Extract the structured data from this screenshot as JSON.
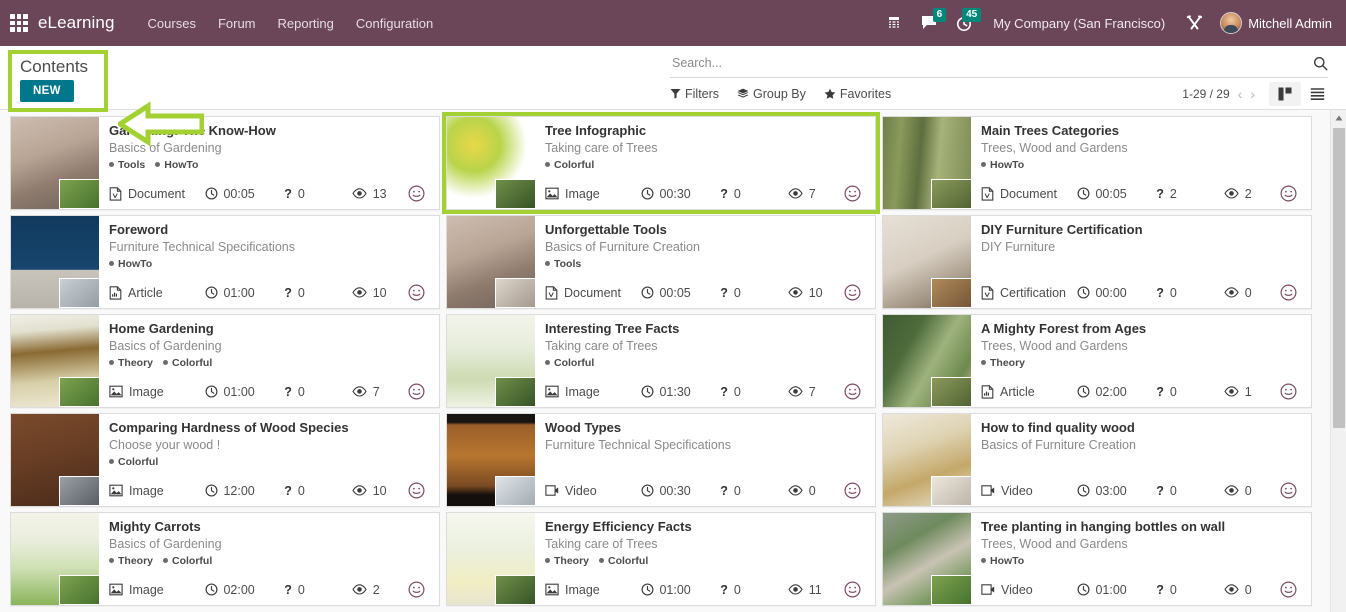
{
  "navbar": {
    "apps_icon": "apps-grid-icon",
    "brand": "eLearning",
    "menu": [
      "Courses",
      "Forum",
      "Reporting",
      "Configuration"
    ],
    "phone_icon": "dialpad-icon",
    "chat_icon": "chat-bubble-icon",
    "chat_badge": "6",
    "clock_icon": "clock-icon",
    "clock_badge": "45",
    "company": "My Company (San Francisco)",
    "debug_icon": "tools-icon",
    "avatar_icon": "user-avatar",
    "user": "Mitchell Admin",
    "accent": "#6b4558",
    "badge_color": "#00887a"
  },
  "control_panel": {
    "breadcrumb": "Contents",
    "new_button": "NEW",
    "new_button_color": "#00778b",
    "highlight_color": "#a3d133",
    "search": {
      "placeholder": "Search...",
      "value": "",
      "icon": "search-icon"
    },
    "filters": [
      {
        "label": "Filters",
        "icon": "funnel-icon"
      },
      {
        "label": "Group By",
        "icon": "layers-icon"
      },
      {
        "label": "Favorites",
        "icon": "star-icon"
      }
    ],
    "pager": "1-29 / 29",
    "prev_icon": "chevron-left-icon",
    "next_icon": "chevron-right-icon",
    "views": [
      {
        "name": "kanban-view",
        "icon": "kanban-icon",
        "active": true
      },
      {
        "name": "list-view",
        "icon": "list-icon",
        "active": false
      }
    ]
  },
  "cards": [
    {
      "title": "Gardening: The Know-How",
      "course": "Basics of Gardening",
      "tags": [
        "Tools",
        "HowTo"
      ],
      "type": "Document",
      "type_icon": "document-icon",
      "duration": "00:05",
      "questions": "0",
      "views": "13",
      "smiley_icon": "smiley-icon",
      "highlighted": false,
      "thumb": "desk-mug-phone",
      "thumb_css": "linear-gradient(160deg,#cdbdb0 0%,#b9a596 38%,#8e7b6e 66%,#6f625a 100%)",
      "inset_css": "linear-gradient(140deg,#7da14f,#3f6b2a)"
    },
    {
      "title": "Tree Infographic",
      "course": "Taking care of Trees",
      "tags": [
        "Colorful"
      ],
      "type": "Image",
      "type_icon": "image-icon",
      "duration": "00:30",
      "questions": "0",
      "views": "7",
      "smiley_icon": "smiley-icon",
      "highlighted": true,
      "thumb": "tree-infographic",
      "thumb_css": "radial-gradient(circle at 30% 30%,#e8d84a 0%,#b9d44a 30%,#ffffff 60%),linear-gradient(#ffffff,#ffffff)",
      "inset_css": "linear-gradient(140deg,#6f8f4a,#2f4a22)"
    },
    {
      "title": "Main Trees Categories",
      "course": "Trees, Wood and Gardens",
      "tags": [
        "HowTo"
      ],
      "type": "Document",
      "type_icon": "document-icon",
      "duration": "00:05",
      "questions": "2",
      "views": "2",
      "smiley_icon": "smiley-icon",
      "highlighted": false,
      "thumb": "forest-trees",
      "thumb_css": "linear-gradient(95deg,#6f7f4a 0%,#8a9a5b 20%,#5e6e3f 42%,#a8b27a 62%,#7b8a55 100%)",
      "inset_css": "linear-gradient(140deg,#8a9a5b,#4a5b2f)"
    },
    {
      "title": "Foreword",
      "course": "Furniture Technical Specifications",
      "tags": [
        "HowTo"
      ],
      "type": "Article",
      "type_icon": "article-icon",
      "duration": "01:00",
      "questions": "0",
      "views": "10",
      "smiley_icon": "smiley-icon",
      "highlighted": false,
      "thumb": "blue-living-room",
      "thumb_css": "linear-gradient(180deg,#123a5e 0%,#16456d 58%,#c9c4bb 59%,#b8b3ab 100%)",
      "inset_css": "linear-gradient(140deg,#c9cfd4,#8d959c)"
    },
    {
      "title": "Unforgettable Tools",
      "course": "Basics of Furniture Creation",
      "tags": [
        "Tools"
      ],
      "type": "Document",
      "type_icon": "document-icon",
      "duration": "00:05",
      "questions": "0",
      "views": "10",
      "smiley_icon": "smiley-icon",
      "highlighted": false,
      "thumb": "desk-mug-phone",
      "thumb_css": "linear-gradient(160deg,#cdbdb0 0%,#b9a596 38%,#8e7b6e 66%,#6f625a 100%)",
      "inset_css": "linear-gradient(140deg,#ddd6cc,#9b8f83)"
    },
    {
      "title": "DIY Furniture Certification",
      "course": "DIY Furniture",
      "tags": [],
      "type": "Certification",
      "type_icon": "certification-icon",
      "duration": "00:00",
      "questions": "0",
      "views": "0",
      "smiley_icon": "smiley-icon",
      "highlighted": false,
      "thumb": "desk-flowers",
      "thumb_css": "linear-gradient(155deg,#e6e0d6 0%,#d8cfc2 45%,#9c8f7e 80%,#6d6054 100%)",
      "inset_css": "linear-gradient(140deg,#b08a5a,#6b4f33)"
    },
    {
      "title": "Home Gardening",
      "course": "Basics of Gardening",
      "tags": [
        "Theory",
        "Colorful"
      ],
      "type": "Image",
      "type_icon": "image-icon",
      "duration": "01:00",
      "questions": "0",
      "views": "7",
      "smiley_icon": "smiley-icon",
      "highlighted": false,
      "thumb": "home-gardening-infographic",
      "thumb_css": "linear-gradient(175deg,#f0efe6 0%,#e2e0cf 18%,#8a6a33 40%,#d7cfa8 70%,#eee9d6 100%)",
      "inset_css": "linear-gradient(140deg,#7da14f,#3f6b2a)"
    },
    {
      "title": "Interesting Tree Facts",
      "course": "Taking care of Trees",
      "tags": [
        "Colorful"
      ],
      "type": "Image",
      "type_icon": "image-icon",
      "duration": "01:30",
      "questions": "0",
      "views": "7",
      "smiley_icon": "smiley-icon",
      "highlighted": false,
      "thumb": "tree-facts-infographic",
      "thumb_css": "linear-gradient(180deg,#f2f4ea 0%,#e7eddc 35%,#cddbb2 70%,#eef2e4 100%)",
      "inset_css": "linear-gradient(140deg,#6f8f4a,#2f4a22)"
    },
    {
      "title": "A Mighty Forest from Ages",
      "course": "Trees, Wood and Gardens",
      "tags": [
        "Theory"
      ],
      "type": "Article",
      "type_icon": "article-icon",
      "duration": "02:00",
      "questions": "0",
      "views": "1",
      "smiley_icon": "smiley-icon",
      "highlighted": false,
      "thumb": "green-tree-sky",
      "thumb_css": "linear-gradient(120deg,#3f5b33 0%,#4e6b3c 30%,#9fb27e 55%,#6d8a4e 80%,#c9bfa6 100%)",
      "inset_css": "linear-gradient(140deg,#8a9a5b,#4a5b2f)"
    },
    {
      "title": "Comparing Hardness of Wood Species",
      "course": "Choose your wood !",
      "tags": [
        "Colorful"
      ],
      "type": "Image",
      "type_icon": "image-icon",
      "duration": "12:00",
      "questions": "0",
      "views": "10",
      "smiley_icon": "smiley-icon",
      "highlighted": false,
      "thumb": "wood-hardness-chart",
      "thumb_css": "linear-gradient(165deg,#7a4a2c 0%,#6a3f25 40%,#5a3520 70%,#4a2b19 100%)",
      "inset_css": "linear-gradient(140deg,#9aa0a6,#4e545a)"
    },
    {
      "title": "Wood Types",
      "course": "Furniture Technical Specifications",
      "tags": [],
      "type": "Video",
      "type_icon": "video-icon",
      "duration": "00:30",
      "questions": "0",
      "views": "0",
      "smiley_icon": "smiley-icon",
      "highlighted": false,
      "thumb": "woman-video-wood",
      "thumb_css": "linear-gradient(180deg,#1a1410 0%,#1a1410 9%,#9a5f2a 12%,#b8762f 45%,#7a4a22 78%,#140f0c 88%,#140f0c 100%)",
      "inset_css": "linear-gradient(140deg,#dfe3e6,#9aa4ac)"
    },
    {
      "title": "How to find quality wood",
      "course": "Basics of Furniture Creation",
      "tags": [],
      "type": "Video",
      "type_icon": "video-icon",
      "duration": "03:00",
      "questions": "0",
      "views": "0",
      "smiley_icon": "smiley-icon",
      "highlighted": false,
      "thumb": "wood-samples",
      "thumb_css": "linear-gradient(160deg,#efe9dc 0%,#ded3b3 35%,#c4a86a 65%,#e9e2d0 100%)",
      "inset_css": "linear-gradient(140deg,#ece7de,#b7ada0)"
    },
    {
      "title": "Mighty Carrots",
      "course": "Basics of Gardening",
      "tags": [
        "Theory",
        "Colorful"
      ],
      "type": "Image",
      "type_icon": "image-icon",
      "duration": "02:00",
      "questions": "0",
      "views": "2",
      "smiley_icon": "smiley-icon",
      "highlighted": false,
      "thumb": "carrots-infographic",
      "thumb_css": "linear-gradient(180deg,#f4f3e8 0%,#e9eedc 30%,#cfe0b4 60%,#8ab45a 100%)",
      "inset_css": "linear-gradient(140deg,#7da14f,#3f6b2a)"
    },
    {
      "title": "Energy Efficiency Facts",
      "course": "Taking care of Trees",
      "tags": [
        "Theory",
        "Colorful"
      ],
      "type": "Image",
      "type_icon": "image-icon",
      "duration": "01:00",
      "questions": "0",
      "views": "11",
      "smiley_icon": "smiley-icon",
      "highlighted": false,
      "thumb": "energy-efficiency-infographic",
      "thumb_css": "linear-gradient(180deg,#f6f7ef 0%,#eaf0de 40%,#f2eec4 75%,#e7e4cf 100%)",
      "inset_css": "linear-gradient(140deg,#6f8f4a,#2f4a22)"
    },
    {
      "title": "Tree planting in hanging bottles on wall",
      "course": "Trees, Wood and Gardens",
      "tags": [
        "HowTo"
      ],
      "type": "Video",
      "type_icon": "video-icon",
      "duration": "01:00",
      "questions": "0",
      "views": "0",
      "smiley_icon": "smiley-icon",
      "highlighted": false,
      "thumb": "hanging-bottle-plants",
      "thumb_css": "linear-gradient(150deg,#8f9a8a 0%,#6f8a5e 30%,#c8c3b4 55%,#7a9a60 80%,#9a8f86 100%)",
      "inset_css": "linear-gradient(140deg,#7da14f,#3f6b2a)"
    }
  ],
  "scrollbar": {
    "name": "vertical-scrollbar",
    "thumb_position": "top"
  }
}
